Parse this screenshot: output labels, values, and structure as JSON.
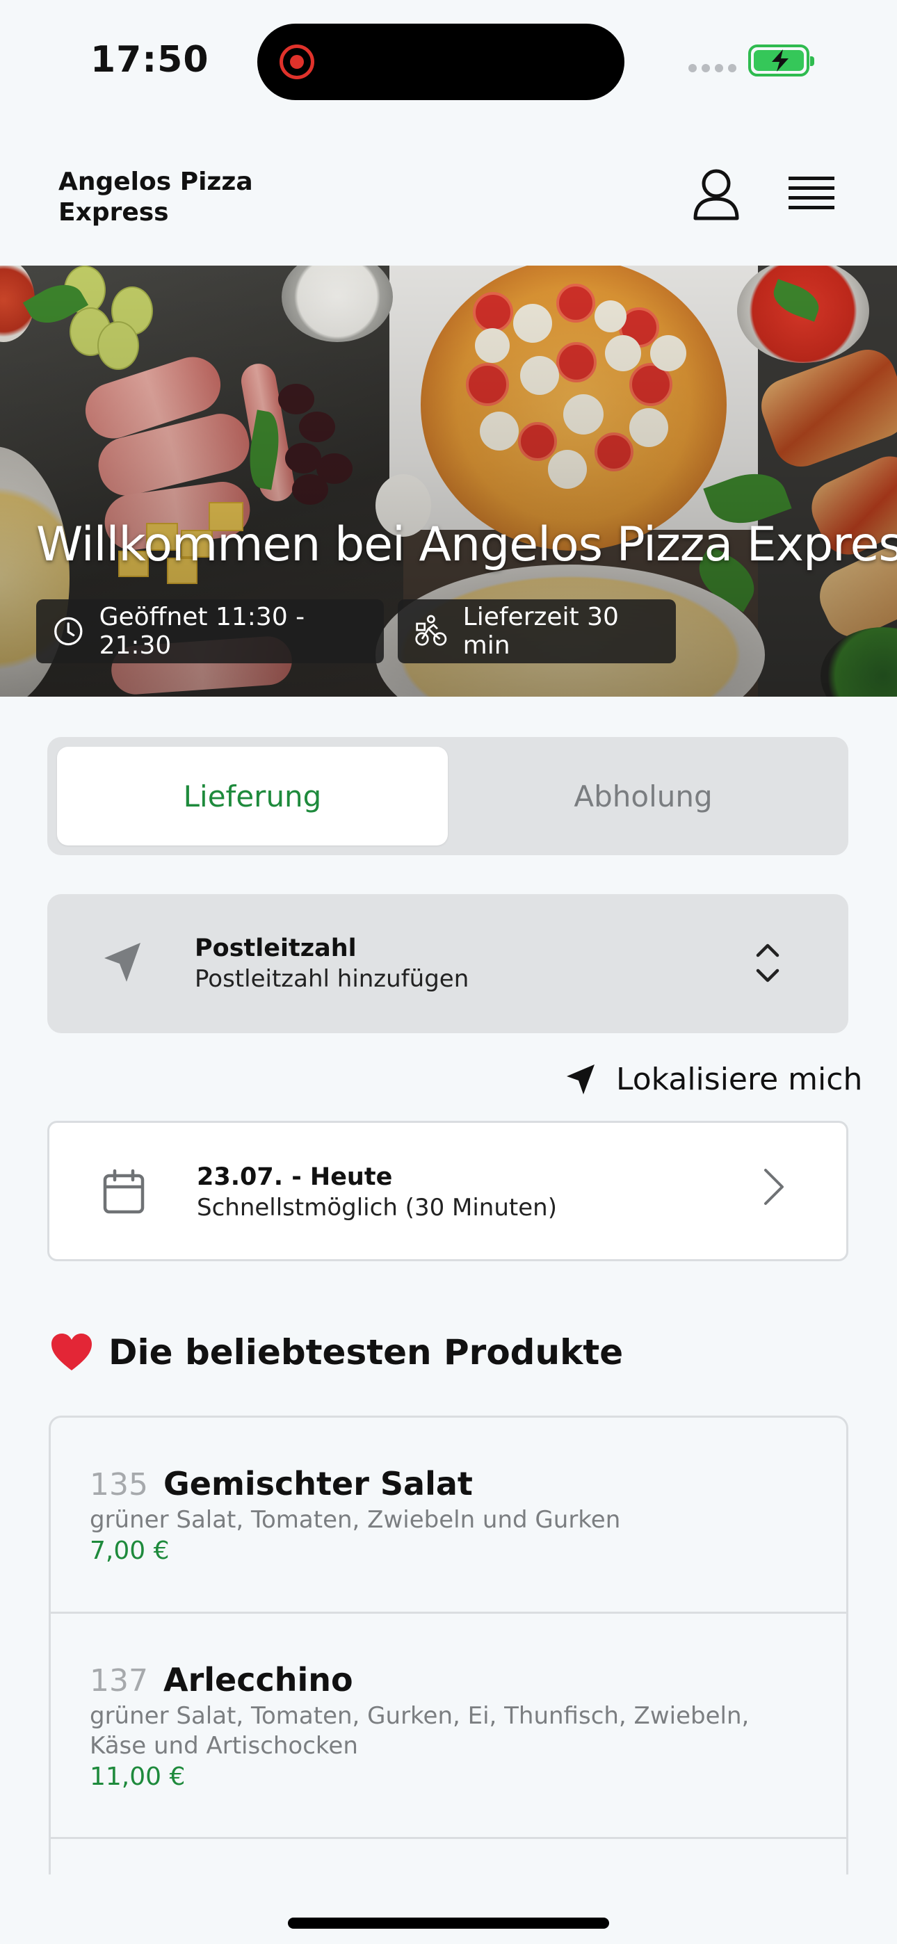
{
  "status_bar": {
    "time": "17:50"
  },
  "header": {
    "brand": "Angelos Pizza Express"
  },
  "hero": {
    "title": "Willkommen bei Angelos Pizza Express",
    "opening_hours": "Geöffnet 11:30 - 21:30",
    "delivery_time": "Lieferzeit 30 min"
  },
  "tabs": [
    {
      "label": "Lieferung",
      "active": true
    },
    {
      "label": "Abholung",
      "active": false
    }
  ],
  "postcode": {
    "title": "Postleitzahl",
    "placeholder": "Postleitzahl hinzufügen"
  },
  "locate": {
    "label": "Lokalisiere mich"
  },
  "date": {
    "title": "23.07. - Heute",
    "subtitle": "Schnellstmöglich (30 Minuten)"
  },
  "section": {
    "title": "Die beliebtesten Produkte"
  },
  "products": [
    {
      "number": "135",
      "name": "Gemischter Salat",
      "description": "grüner Salat, Tomaten, Zwiebeln und Gurken",
      "price": "7,00 €"
    },
    {
      "number": "137",
      "name": "Arlecchino",
      "description": "grüner Salat, Tomaten, Gurken, Ei, Thunfisch, Zwiebeln, Käse und Artischocken",
      "price": "11,00 €"
    }
  ],
  "colors": {
    "accent_green": "#1e8a3c",
    "panel_gray": "#e0e2e4",
    "background": "#f5f8fa"
  }
}
